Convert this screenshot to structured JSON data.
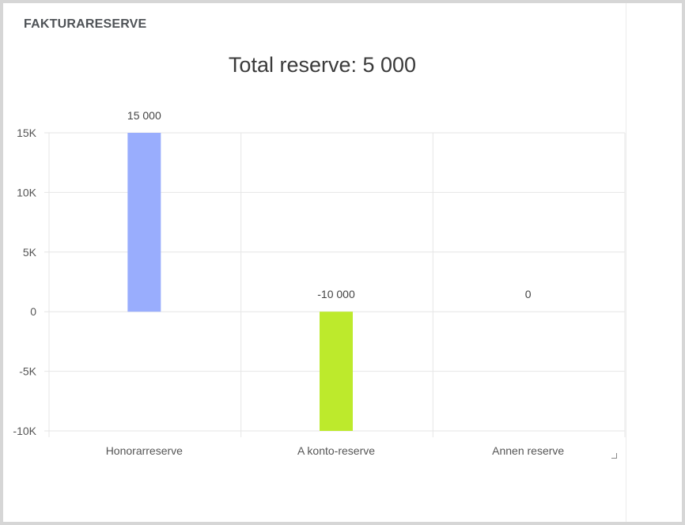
{
  "panel": {
    "title": "FAKTURARESERVE"
  },
  "chart_data": {
    "type": "bar",
    "title": "Total reserve: 5 000",
    "categories": [
      "Honorarreserve",
      "A konto-reserve",
      "Annen reserve"
    ],
    "values": [
      15000,
      -10000,
      0
    ],
    "value_labels": [
      "15 000",
      "-10 000",
      "0"
    ],
    "colors": [
      "#99adfd",
      "#bdea2c",
      "#cccccc"
    ],
    "ylim": [
      -10000,
      15000
    ],
    "yticks": [
      15000,
      10000,
      5000,
      0,
      -5000,
      -10000
    ],
    "ytick_labels": [
      "15K",
      "10K",
      "5K",
      "0",
      "-5K",
      "-10K"
    ],
    "xlabel": "",
    "ylabel": "",
    "grid": true,
    "legend": "none"
  },
  "icons": {
    "resize": "resize-corner-icon"
  }
}
